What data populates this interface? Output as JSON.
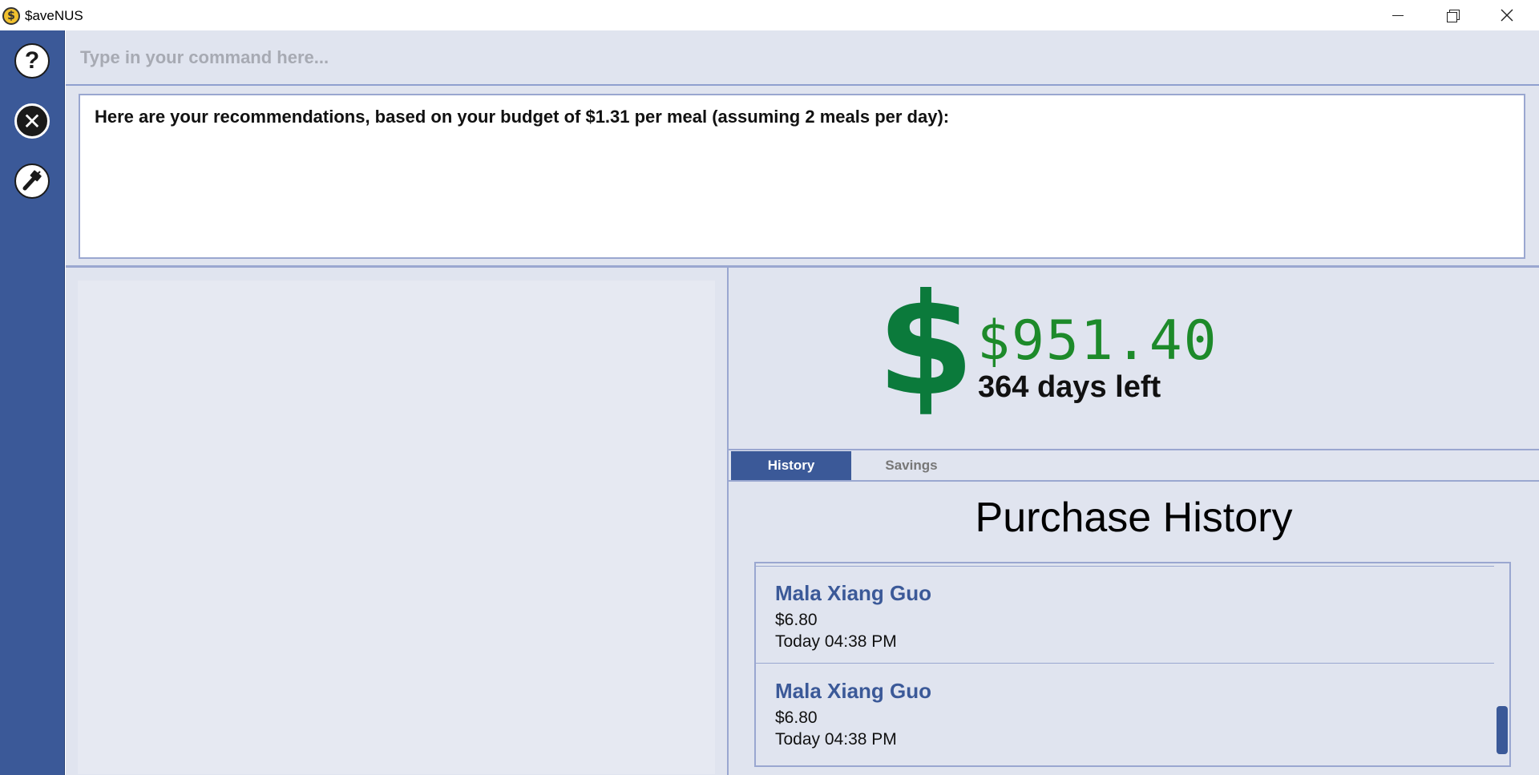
{
  "window": {
    "app_icon": "$",
    "title": "$aveNUS",
    "controls": [
      "minimize-icon",
      "maximize-icon",
      "close-icon"
    ]
  },
  "sidebar": {
    "items": [
      {
        "name": "help",
        "icon": "question-icon",
        "glyph": "?"
      },
      {
        "name": "exit",
        "icon": "close-circle-icon",
        "glyph": "✕"
      },
      {
        "name": "theme",
        "icon": "paint-brush-icon"
      }
    ]
  },
  "command": {
    "placeholder": "Type in your command here...",
    "value": ""
  },
  "result": {
    "text": "Here are your recommendations, based on your budget of $1.31 per meal (assuming 2 meals per day):"
  },
  "budget": {
    "symbol": "$",
    "amount": "$951.40",
    "days_left": "364 days left",
    "colors": {
      "symbol": "#0b7a3b",
      "amount": "#1d8a2a"
    }
  },
  "tabs": [
    {
      "label": "History",
      "active": true
    },
    {
      "label": "Savings",
      "active": false
    }
  ],
  "history": {
    "title": "Purchase History",
    "items": [
      {
        "name": "Mala Xiang Guo",
        "price": "$6.80",
        "time": "Today 04:38 PM"
      },
      {
        "name": "Mala Xiang Guo",
        "price": "$6.80",
        "time": "Today 04:38 PM"
      }
    ]
  },
  "colors": {
    "accent": "#3b5998",
    "panel_bg": "#e0e4ef",
    "border": "#9aa7d0"
  }
}
